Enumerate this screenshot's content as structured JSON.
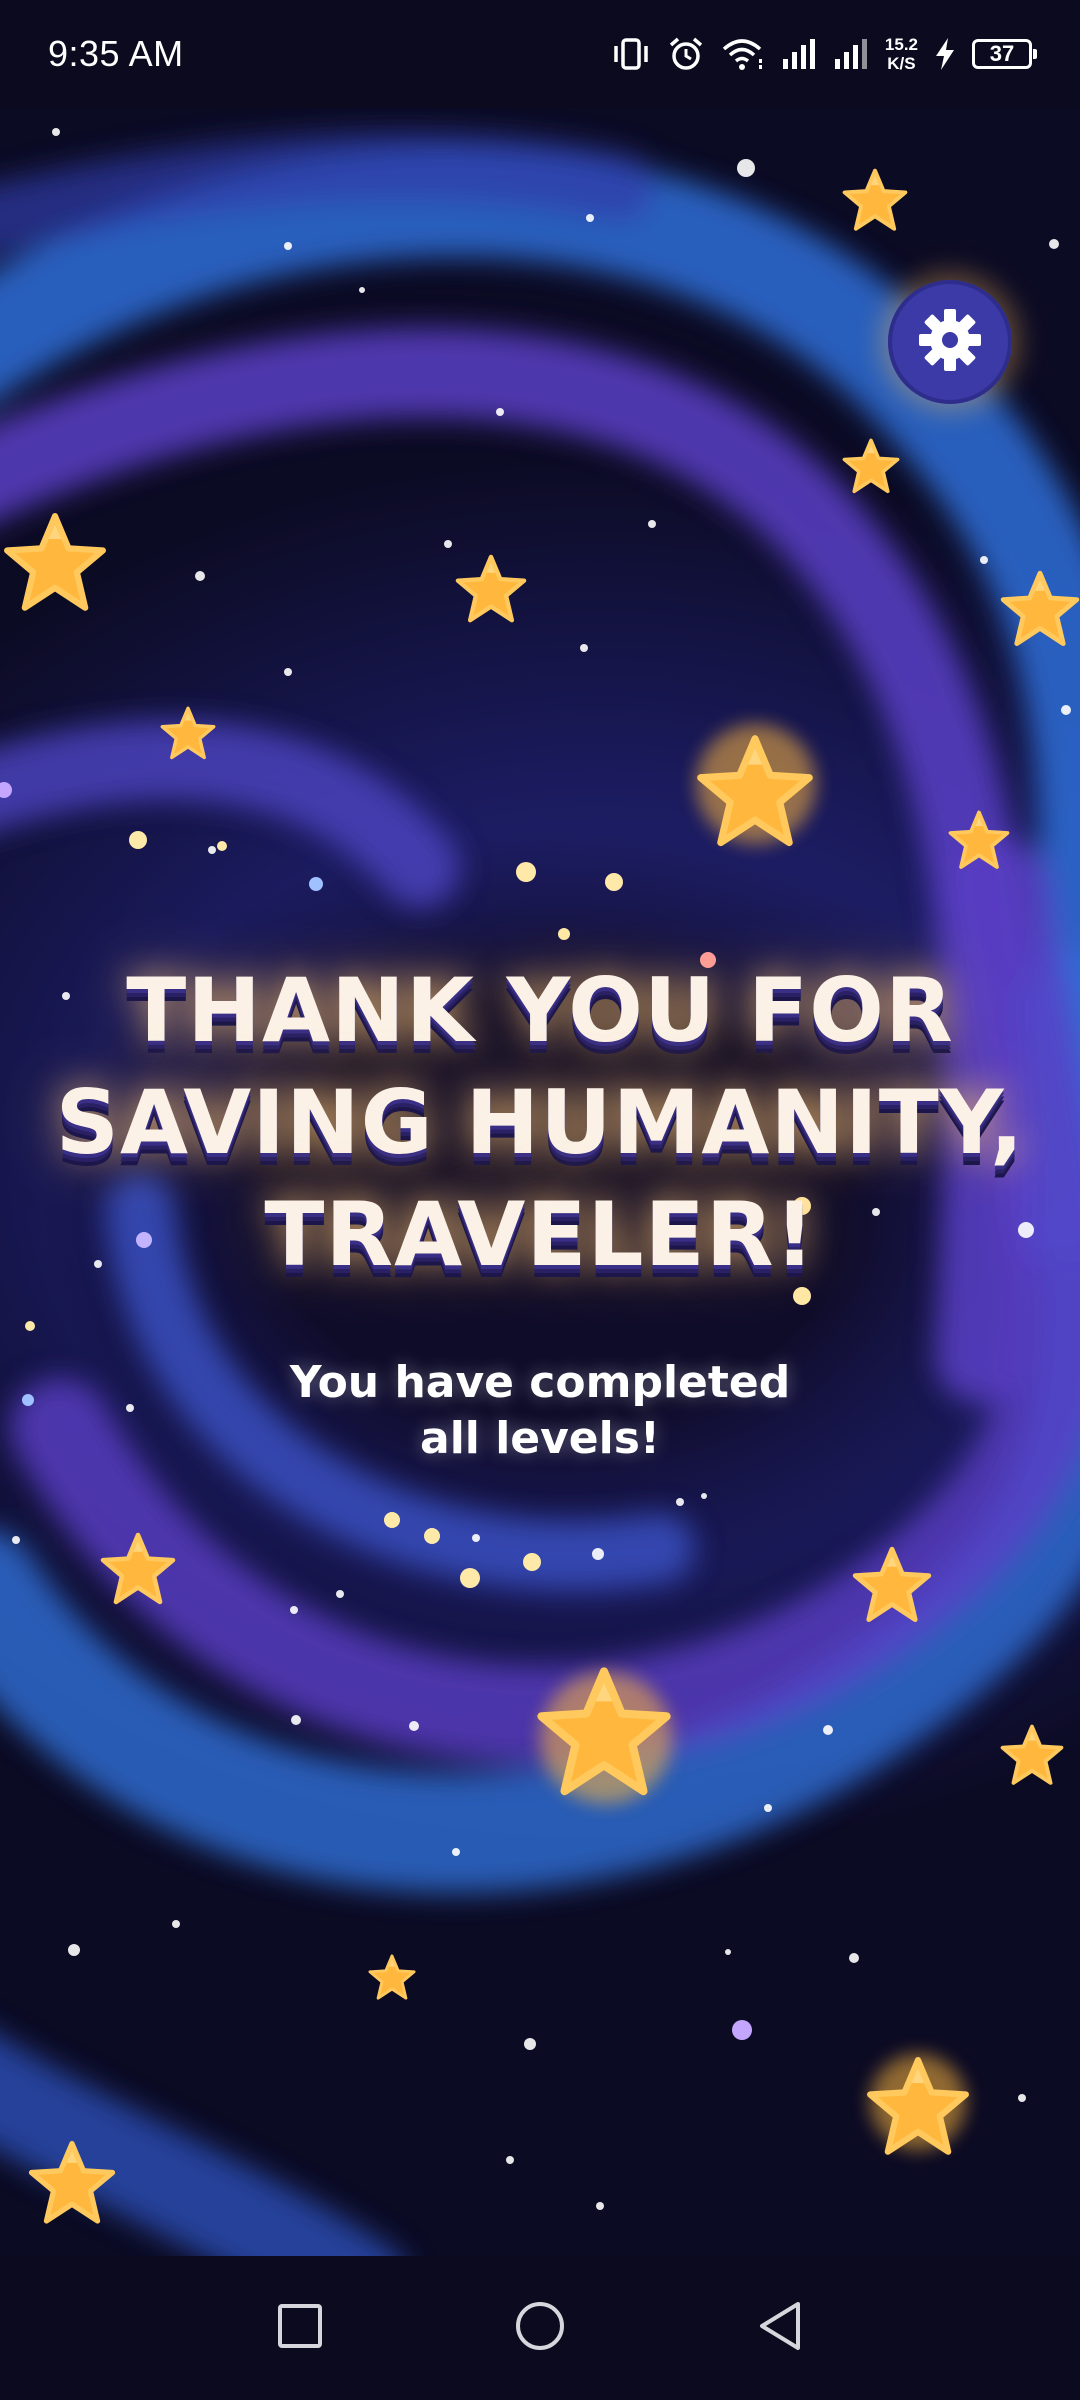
{
  "status_bar": {
    "time": "9:35 AM",
    "net_speed_value": "15.2",
    "net_speed_unit": "K/S",
    "battery_level": "37",
    "icons": [
      "vibrate-icon",
      "alarm-icon",
      "wifi-icon",
      "signal-icon",
      "signal-icon",
      "charging-icon"
    ]
  },
  "settings": {
    "icon": "gear-icon"
  },
  "headline": {
    "line1": "THANK YOU FOR",
    "line2": "SAVING HUMANITY,",
    "line3": "TRAVELER!"
  },
  "subtitle": {
    "line1": "You have completed",
    "line2": "all levels!"
  },
  "nav_bar": {
    "buttons": [
      "recents-icon",
      "home-icon",
      "back-icon"
    ]
  },
  "colors": {
    "background": "#0b0a1e",
    "swirl_blue": "#2f6fd8",
    "swirl_violet": "#5a3fc6",
    "star": "#ffb83d",
    "headline_text": "#fbf1e6",
    "settings_button": "#3b3aa6"
  }
}
